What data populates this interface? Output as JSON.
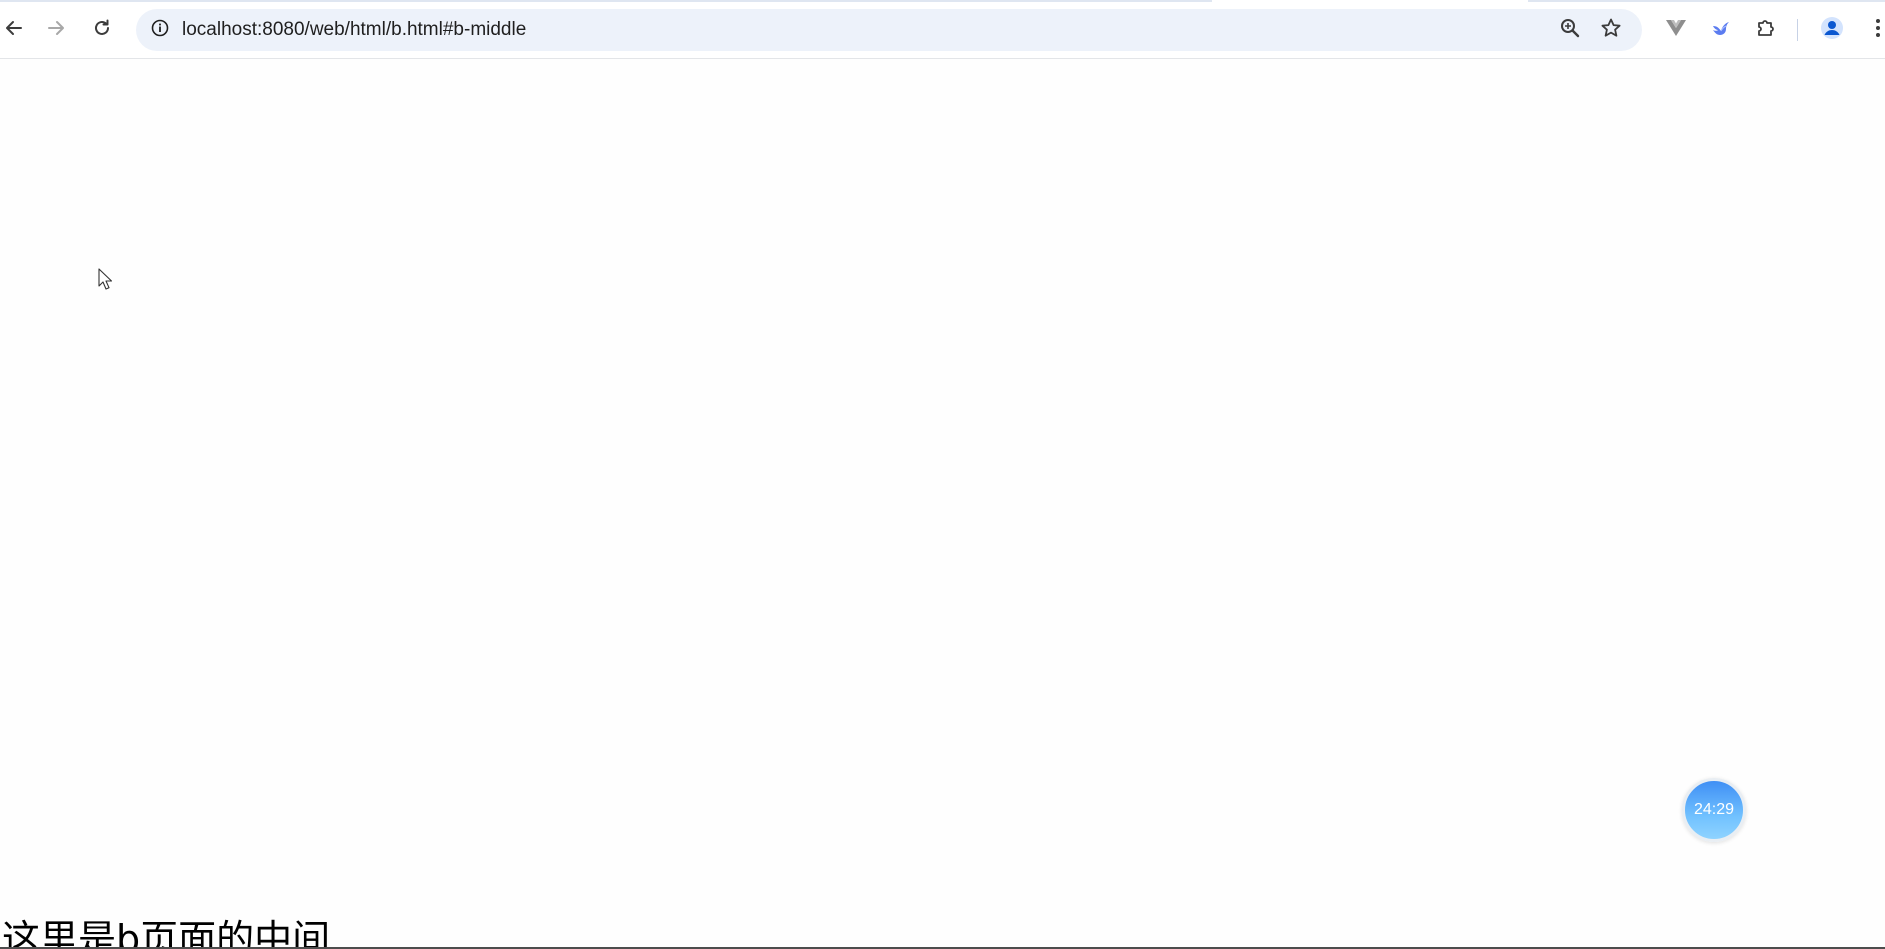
{
  "browser": {
    "address_bar": {
      "url": "localhost:8080/web/html/b.html#b-middle"
    },
    "nav": [
      "back-icon",
      "forward-icon",
      "reload-icon"
    ],
    "omnibox_actions": [
      "zoom-icon",
      "bookmark-star-icon"
    ],
    "extensions": [
      "vue-devtools-icon",
      "bird-extension-icon",
      "puzzle-extensions-icon"
    ],
    "profile": "profile-avatar-icon",
    "menu": "kebab-menu-icon"
  },
  "page": {
    "heading": "这里是b页面的中间",
    "timer_widget": {
      "label": "24:29"
    }
  },
  "colors": {
    "omnibox_bg": "#edf2fa",
    "timer_gradient_top": "#3f8ff5",
    "timer_gradient_bottom": "#8fd3ff",
    "profile_blue": "#0b57d0"
  }
}
